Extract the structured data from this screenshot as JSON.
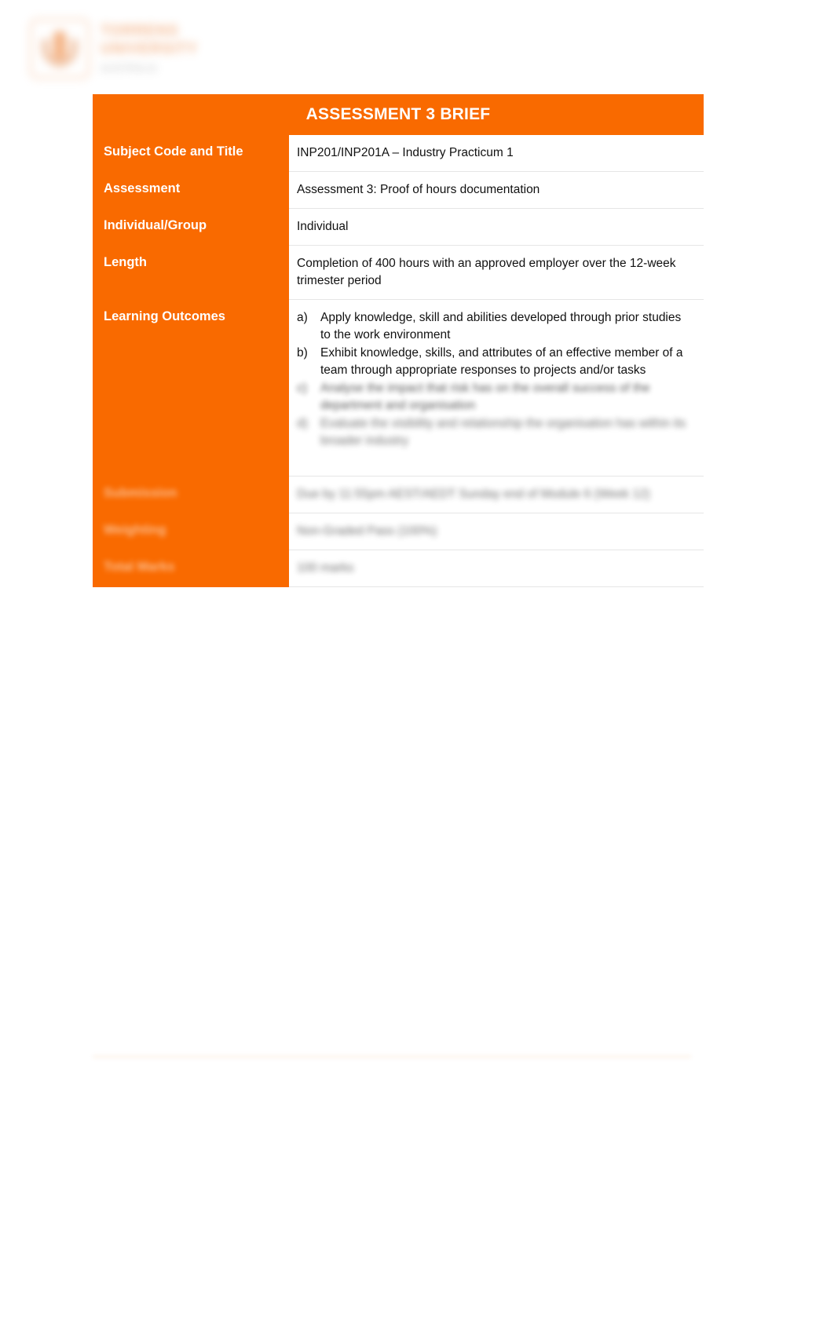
{
  "document": {
    "type": "assessment-brief",
    "accent_color": "#F96A00",
    "text_color": "#111111",
    "page_background": "#FFFFFF"
  },
  "logo": {
    "line1": "TORRENS",
    "line2": "UNIVERSITY",
    "line3": "AUSTRALIA",
    "icon": "torrens-crest-icon",
    "legible": false
  },
  "table": {
    "title": "ASSESSMENT 3 BRIEF",
    "rows": [
      {
        "label": "Subject Code and Title",
        "value": "INP201/INP201A – Industry Practicum 1",
        "legible": true
      },
      {
        "label": "Assessment",
        "value": "Assessment 3: Proof of hours documentation",
        "legible": true
      },
      {
        "label": "Individual/Group",
        "value": "Individual",
        "legible": true
      },
      {
        "label": "Length",
        "value": "Completion of 400 hours with an approved employer over the 12-week trimester period",
        "legible": true
      },
      {
        "label": "Learning Outcomes",
        "value": "",
        "legible": true,
        "list": [
          {
            "marker": "a)",
            "text": "Apply knowledge, skill and abilities developed through prior studies to the work environment",
            "legible": true
          },
          {
            "marker": "b)",
            "text": "Exhibit knowledge, skills, and attributes of an effective member of a team through appropriate responses to projects and/or tasks",
            "legible": true
          },
          {
            "marker": "c)",
            "text": "Analyse the impact that risk has on the overall success of the department and organisation",
            "legible": false
          },
          {
            "marker": "d)",
            "text": "Evaluate the visibility and relationship the organisation has within its broader industry",
            "legible": false
          }
        ]
      },
      {
        "label": "Submission",
        "value": "Due by 11:55pm AEST/AEDT Sunday end of Module 6 (Week 12)",
        "legible": false
      },
      {
        "label": "Weighting",
        "value": "Non-Graded Pass (100%)",
        "legible": false
      },
      {
        "label": "Total Marks",
        "value": "100 marks",
        "legible": false
      }
    ]
  },
  "footer": {
    "rule_visible": true
  }
}
